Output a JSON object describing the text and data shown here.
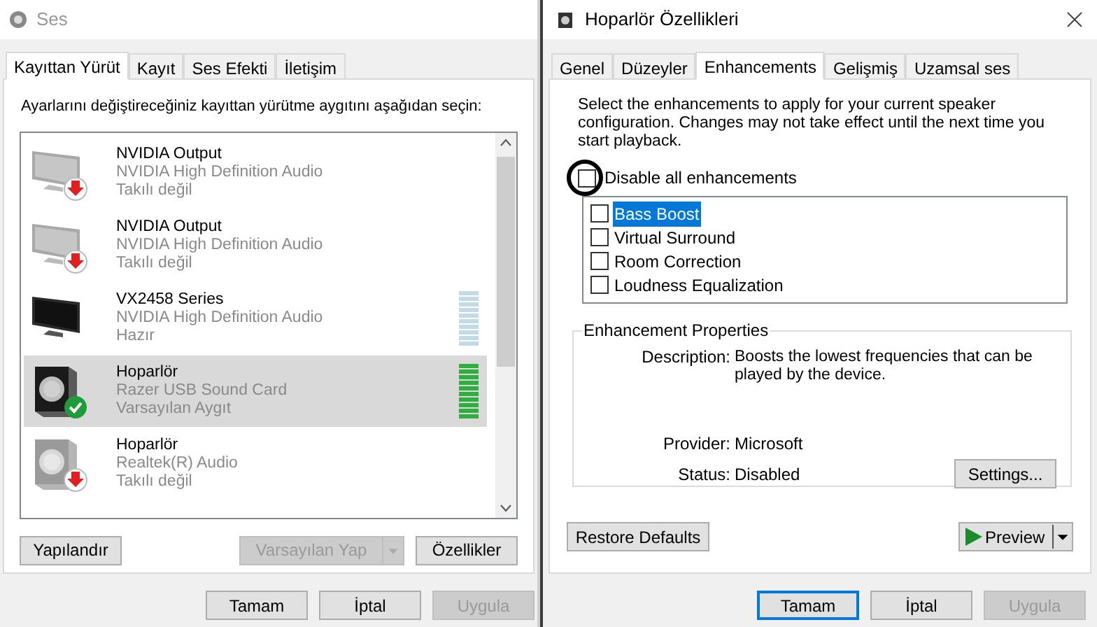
{
  "left_window": {
    "title": "Ses",
    "tabs": [
      {
        "label": "Kayıttan Yürüt",
        "selected": true
      },
      {
        "label": "Kayıt",
        "selected": false
      },
      {
        "label": "Ses Efekti",
        "selected": false
      },
      {
        "label": "İletişim",
        "selected": false
      }
    ],
    "instruction": "Ayarlarını değiştireceğiniz kayıttan yürütme aygıtını aşağıdan seçin:",
    "devices": [
      {
        "kind": "monitor",
        "name": "NVIDIA Output",
        "driver": "NVIDIA High Definition Audio",
        "status": "Takılı değil",
        "plugged_in": false,
        "default": false,
        "selected": false
      },
      {
        "kind": "monitor",
        "name": "NVIDIA Output",
        "driver": "NVIDIA High Definition Audio",
        "status": "Takılı değil",
        "plugged_in": false,
        "default": false,
        "selected": false
      },
      {
        "kind": "monitor",
        "name": "VX2458 Series",
        "driver": "NVIDIA High Definition Audio",
        "status": "Hazır",
        "plugged_in": true,
        "default": false,
        "selected": false,
        "meter": {
          "active": false
        }
      },
      {
        "kind": "speaker",
        "name": "Hoparlör",
        "driver": "Razer USB Sound Card",
        "status": "Varsayılan Aygıt",
        "plugged_in": true,
        "default": true,
        "selected": true,
        "meter": {
          "active": true
        }
      },
      {
        "kind": "speaker",
        "name": "Hoparlör",
        "driver": "Realtek(R) Audio",
        "status": "Takılı değil",
        "plugged_in": false,
        "default": false,
        "selected": false
      }
    ],
    "buttons": [
      {
        "label": "Yapılandır",
        "disabled": false
      },
      {
        "label": "Varsayılan Yap",
        "disabled": true,
        "split": true
      },
      {
        "label": "Özellikler",
        "disabled": false
      }
    ],
    "footer_buttons": [
      {
        "label": "Tamam",
        "disabled": false
      },
      {
        "label": "İptal",
        "disabled": false
      },
      {
        "label": "Uygula",
        "disabled": true
      }
    ]
  },
  "right_window": {
    "title": "Hoparlör Özellikleri",
    "tabs": [
      {
        "label": "Genel",
        "selected": false
      },
      {
        "label": "Düzeyler",
        "selected": false
      },
      {
        "label": "Enhancements",
        "selected": true
      },
      {
        "label": "Gelişmiş",
        "selected": false
      },
      {
        "label": "Uzamsal ses",
        "selected": false
      }
    ],
    "instruction": "Select the enhancements to apply for your current speaker configuration. Changes may not take effect until the next time you start playback.",
    "disable_all": {
      "label": "Disable all enhancements",
      "checked": false
    },
    "enhancements": [
      {
        "label": "Bass Boost",
        "checked": false,
        "selected": true
      },
      {
        "label": "Virtual Surround",
        "checked": false,
        "selected": false
      },
      {
        "label": "Room Correction",
        "checked": false,
        "selected": false
      },
      {
        "label": "Loudness Equalization",
        "checked": false,
        "selected": false
      }
    ],
    "properties": {
      "legend": "Enhancement Properties",
      "description_label": "Description:",
      "description": "Boosts the lowest frequencies that can be played by the device.",
      "provider_label": "Provider:",
      "provider": "Microsoft",
      "status_label": "Status:",
      "status": "Disabled",
      "settings_button": "Settings..."
    },
    "restore_button": "Restore Defaults",
    "preview_button": "Preview",
    "footer_buttons": [
      {
        "label": "Tamam",
        "disabled": false,
        "default": true
      },
      {
        "label": "İptal",
        "disabled": false,
        "default": false
      },
      {
        "label": "Uygula",
        "disabled": true,
        "default": false
      }
    ]
  }
}
